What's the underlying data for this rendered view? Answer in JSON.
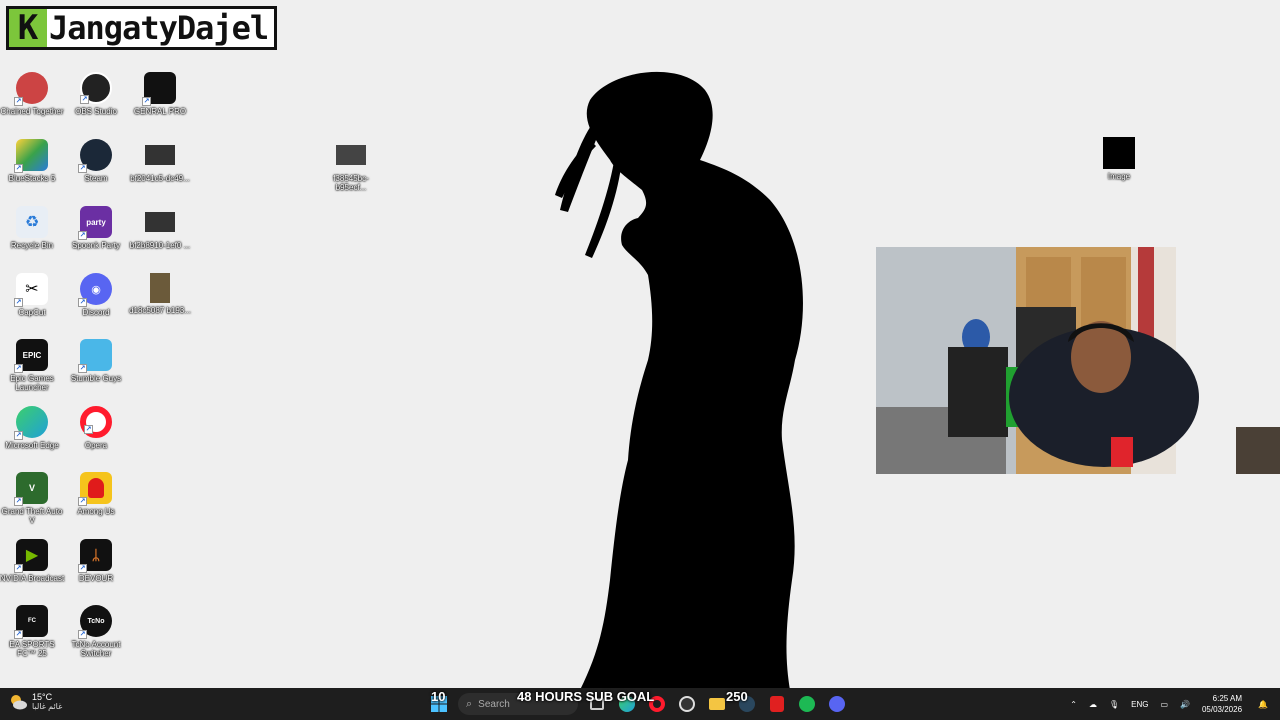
{
  "overlay": {
    "logo_letter": "K",
    "logo_name": "JangatyDajel",
    "goal_left": "10",
    "goal_text": "48 HOURS SUB GOAL",
    "goal_right": "250"
  },
  "desktop": {
    "icons": [
      {
        "label": "Chained Together",
        "icon": "chained-together-icon",
        "color": "#c44"
      },
      {
        "label": "OBS Studio",
        "icon": "obs-icon",
        "color": "#222"
      },
      {
        "label": "GENRAL PRO",
        "icon": "genral-pro-icon",
        "color": "#111"
      },
      {
        "label": "BlueStacks 5",
        "icon": "bluestacks-icon",
        "color": "#3aa24a"
      },
      {
        "label": "Steam",
        "icon": "steam-icon",
        "color": "#1b2838"
      },
      {
        "label": "bf2041c5-dc49...",
        "icon": "image-file-icon",
        "color": "#333"
      },
      {
        "label": "f38545bc-b95ecf...",
        "icon": "image-file-icon",
        "color": "#444"
      },
      {
        "label": "Image",
        "icon": "black-image-icon",
        "color": "#000"
      },
      {
        "label": "Recycle Bin",
        "icon": "recycle-bin-icon",
        "color": "#e8eef5"
      },
      {
        "label": "Spoonk Party",
        "icon": "spoonk-party-icon",
        "color": "#6b2fa3"
      },
      {
        "label": "bf2b8910-1ef0 ...",
        "icon": "image-file-icon",
        "color": "#333"
      },
      {
        "label": "CapCut",
        "icon": "capcut-icon",
        "color": "#fff"
      },
      {
        "label": "Discord",
        "icon": "discord-icon",
        "color": "#5865f2"
      },
      {
        "label": "d18c5087 b193...",
        "icon": "image-file-icon",
        "color": "#6b5a3a"
      },
      {
        "label": "Epic Games Launcher",
        "icon": "epic-games-icon",
        "color": "#111"
      },
      {
        "label": "Stumble Guys",
        "icon": "stumble-guys-icon",
        "color": "#4ab7e8"
      },
      {
        "label": "Microsoft Edge",
        "icon": "edge-icon",
        "color": "#1fa0d8"
      },
      {
        "label": "Opera",
        "icon": "opera-icon",
        "color": "#ff1b2d"
      },
      {
        "label": "Grand Theft Auto V",
        "icon": "gta-icon",
        "color": "#2d6b2d"
      },
      {
        "label": "Among Us",
        "icon": "among-us-icon",
        "color": "#f5c41c"
      },
      {
        "label": "NVIDIA Broadcast",
        "icon": "nvidia-broadcast-icon",
        "color": "#111"
      },
      {
        "label": "DEVOUR",
        "icon": "devour-icon",
        "color": "#111"
      },
      {
        "label": "EA SPORTS FC™ 25",
        "icon": "ea-fc-icon",
        "color": "#111"
      },
      {
        "label": "TcNo Account Switcher",
        "icon": "tcno-icon",
        "color": "#111"
      }
    ]
  },
  "taskbar": {
    "weather_temp": "15°C",
    "weather_desc": "غائم غالبا",
    "search_placeholder": "Search",
    "lang": "ENG",
    "time": "6:25 AM",
    "date": "05/03/2026"
  }
}
